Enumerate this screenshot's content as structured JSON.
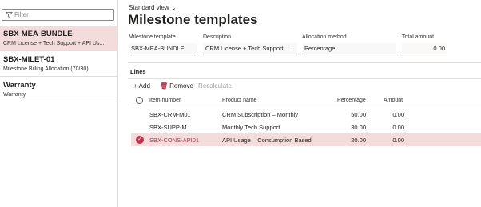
{
  "filter": {
    "placeholder": "Filter"
  },
  "list": [
    {
      "title": "SBX-MEA-BUNDLE",
      "subtitle": "CRM License + Tech Support + API Us..."
    },
    {
      "title": "SBX-MILET-01",
      "subtitle": "Milestone Billing Allocation (70/30)"
    },
    {
      "title": "Warranty",
      "subtitle": "Warranty"
    }
  ],
  "header": {
    "view_label": "Standard view",
    "title": "Milestone templates"
  },
  "fields": {
    "milestone_template": {
      "label": "Milestone template",
      "value": "SBX-MEA-BUNDLE"
    },
    "description": {
      "label": "Description",
      "value": "CRM License + Tech Support ..."
    },
    "allocation_method": {
      "label": "Allocation method",
      "value": "Percentage"
    },
    "total_amount": {
      "label": "Total amount",
      "value": "0.00"
    }
  },
  "lines": {
    "title": "Lines",
    "toolbar": {
      "add": "Add",
      "remove": "Remove",
      "recalculate": "Recalculate"
    },
    "columns": {
      "item_number": "Item number",
      "product_name": "Product name",
      "percentage": "Percentage",
      "amount": "Amount"
    },
    "rows": [
      {
        "item_number": "SBX-CRM-M01",
        "product_name": "CRM Subscription – Monthly",
        "percentage": "50.00",
        "amount": "0.00",
        "selected": false
      },
      {
        "item_number": "SBX-SUPP-M",
        "product_name": "Monthly Tech Support",
        "percentage": "30.00",
        "amount": "0.00",
        "selected": false
      },
      {
        "item_number": "SBX-CONS-API01",
        "product_name": "API Usage – Consumption Based",
        "percentage": "20.00",
        "amount": "0.00",
        "selected": true
      }
    ]
  },
  "colors": {
    "accent": "#c4314b",
    "selected_bg": "#f3dcdb"
  }
}
